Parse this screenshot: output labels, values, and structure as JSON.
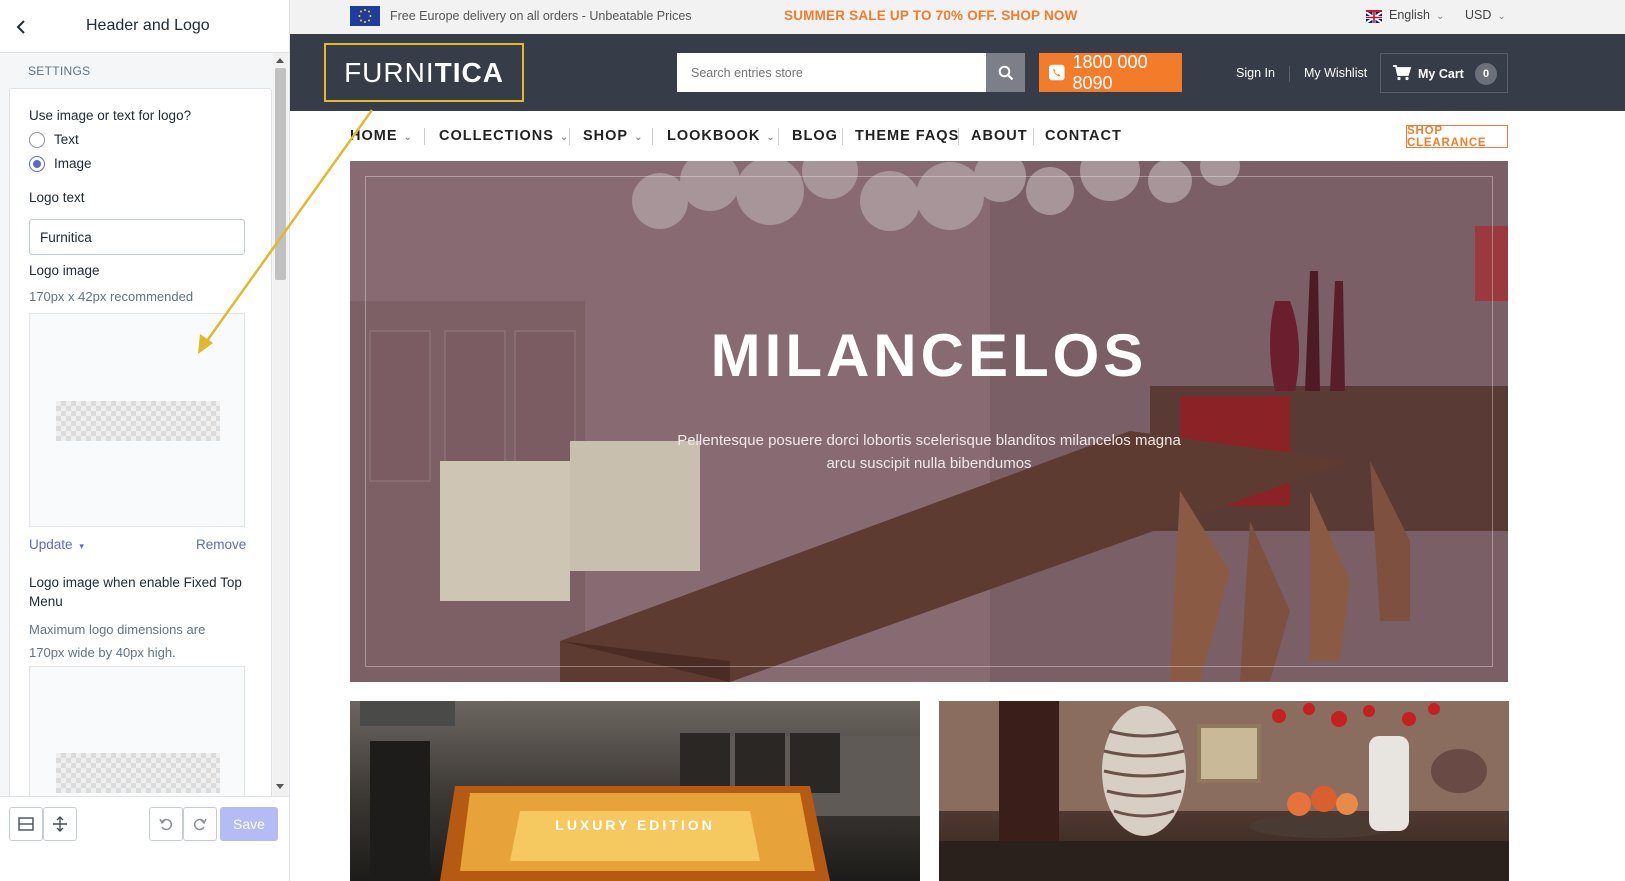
{
  "editor": {
    "title": "Header and Logo",
    "section_label": "SETTINGS",
    "logo_type_question": "Use image or text for logo?",
    "logo_type_options": [
      {
        "label": "Text",
        "checked": false
      },
      {
        "label": "Image",
        "checked": true
      }
    ],
    "logo_text_label": "Logo text",
    "logo_text_value": "Furnitica",
    "logo_image_label": "Logo image",
    "logo_image_hint": "170px x 42px recommended",
    "update_link": "Update",
    "remove_link": "Remove",
    "fixed_logo_label": "Logo image when enable Fixed Top Menu",
    "fixed_logo_hint": "Maximum logo dimensions are 170px wide by 40px high.",
    "save_label": "Save"
  },
  "store": {
    "topbar": {
      "delivery_text": "Free Europe delivery on all orders - Unbeatable Prices",
      "sale_text": "SUMMER SALE UP TO 70% OFF. SHOP NOW",
      "language": "English",
      "currency": "USD"
    },
    "header": {
      "logo_light": "FURNI",
      "logo_bold": "TICA",
      "search_placeholder": "Search entries store",
      "phone": "1800 000 8090",
      "sign_in": "Sign In",
      "wishlist": "My Wishlist",
      "cart_label": "My Cart",
      "cart_count": "0"
    },
    "nav": {
      "items": [
        "HOME",
        "COLLECTIONS",
        "SHOP",
        "LOOKBOOK",
        "BLOG",
        "THEME FAQS",
        "ABOUT",
        "CONTACT"
      ],
      "clearance": "SHOP CLEARANCE"
    },
    "hero": {
      "title": "MILANCELOS",
      "subtitle": "Pellentesque posuere dorci lobortis scelerisque blanditos milancelos magna arcu suscipit nulla bibendumos"
    },
    "promos": [
      {
        "label": "LUXURY EDITION"
      },
      {
        "label": ""
      }
    ]
  },
  "colors": {
    "accent_orange": "#f37c2a",
    "header_dark": "#373d48",
    "highlight_yellow": "#e0b92e",
    "editor_accent": "#5c6ac4"
  }
}
